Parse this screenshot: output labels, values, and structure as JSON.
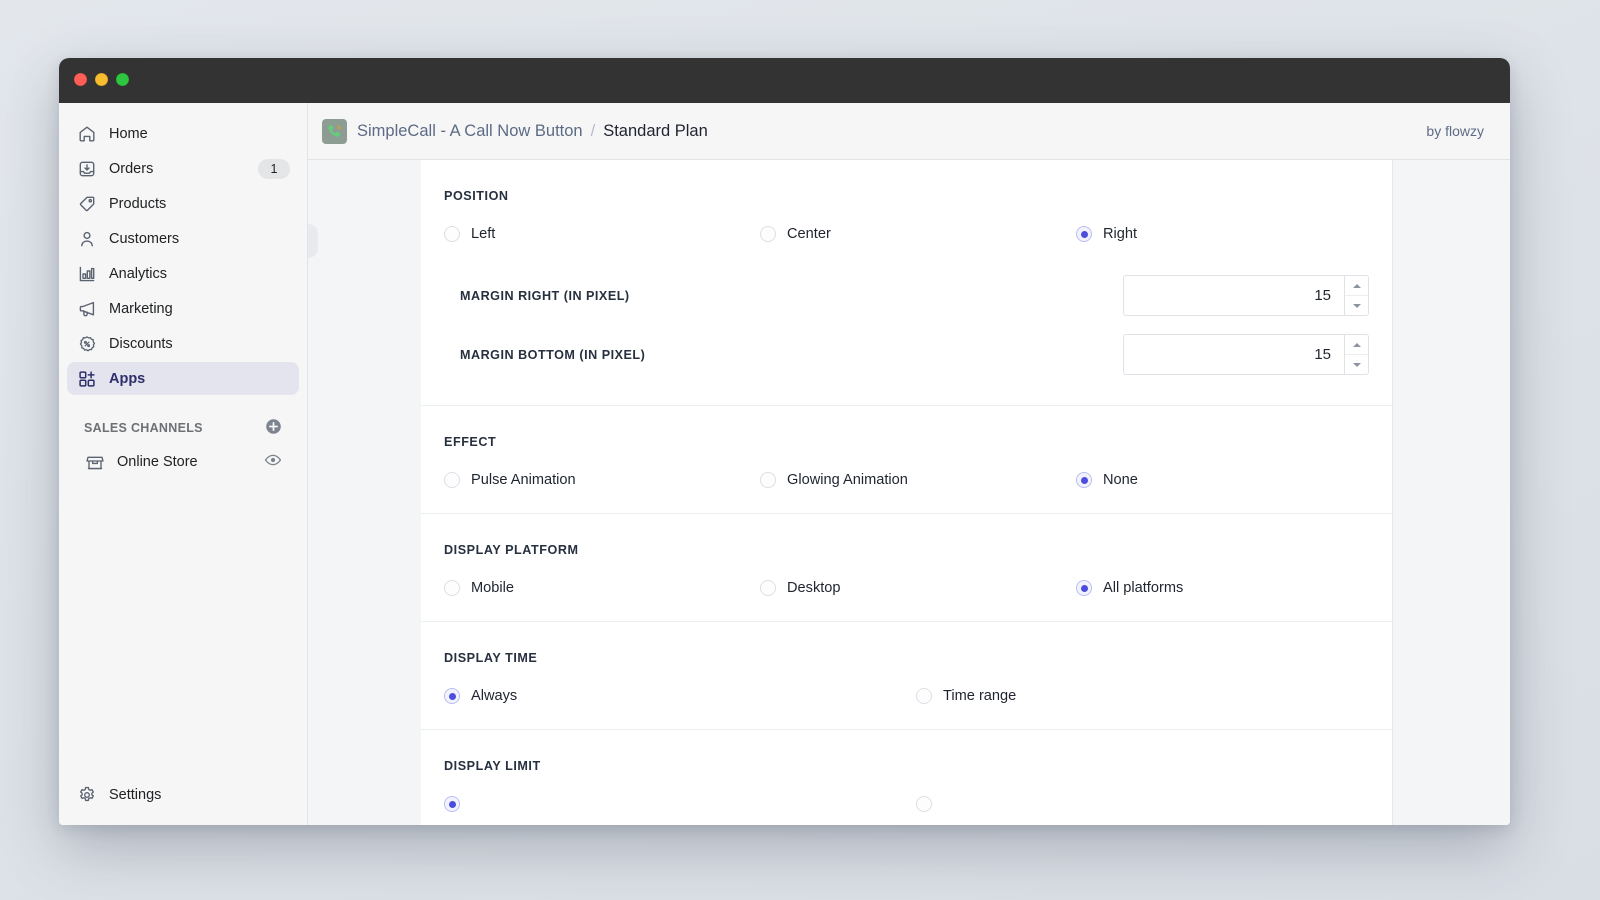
{
  "window": {
    "traffic_lights": [
      "close",
      "minimize",
      "zoom"
    ]
  },
  "sidebar": {
    "items": [
      {
        "label": "Home",
        "icon": "home-icon",
        "badge": null,
        "active": false
      },
      {
        "label": "Orders",
        "icon": "orders-inbox-icon",
        "badge": "1",
        "active": false
      },
      {
        "label": "Products",
        "icon": "product-tag-icon",
        "badge": null,
        "active": false
      },
      {
        "label": "Customers",
        "icon": "customer-person-icon",
        "badge": null,
        "active": false
      },
      {
        "label": "Analytics",
        "icon": "analytics-bars-icon",
        "badge": null,
        "active": false
      },
      {
        "label": "Marketing",
        "icon": "marketing-megaphone-icon",
        "badge": null,
        "active": false
      },
      {
        "label": "Discounts",
        "icon": "discount-percent-icon",
        "badge": null,
        "active": false
      },
      {
        "label": "Apps",
        "icon": "apps-grid-plus-icon",
        "badge": null,
        "active": true
      }
    ],
    "sales_channels": {
      "title": "SALES CHANNELS",
      "add_icon": "plus-circle-icon",
      "channels": [
        {
          "label": "Online Store",
          "icon": "storefront-icon",
          "trailing_icon": "eye-icon"
        }
      ]
    },
    "settings": {
      "label": "Settings",
      "icon": "gear-icon"
    }
  },
  "appbar": {
    "app_icon": "phone-call-app-icon",
    "breadcrumb_app": "SimpleCall - A Call Now Button",
    "breadcrumb_separator": "/",
    "breadcrumb_current": "Standard Plan",
    "byline": "by flowzy"
  },
  "colors": {
    "accent": "#4c4ddb",
    "sidebar_active_bg": "#e3e4ed",
    "title_bar": "#333333",
    "app_icon_bg": "#8e9d94",
    "phone_green": "#5fd07a"
  },
  "settings_panel": {
    "sections": [
      {
        "id": "position",
        "title": "POSITION",
        "options": [
          {
            "label": "Left",
            "selected": false
          },
          {
            "label": "Center",
            "selected": false
          },
          {
            "label": "Right",
            "selected": true
          }
        ],
        "fields": [
          {
            "label": "MARGIN RIGHT (IN PIXEL)",
            "value": "15",
            "unit": "pixel"
          },
          {
            "label": "MARGIN BOTTOM (IN PIXEL)",
            "value": "15",
            "unit": "pixel"
          }
        ]
      },
      {
        "id": "effect",
        "title": "EFFECT",
        "options": [
          {
            "label": "Pulse Animation",
            "selected": false
          },
          {
            "label": "Glowing Animation",
            "selected": false
          },
          {
            "label": "None",
            "selected": true
          }
        ]
      },
      {
        "id": "display_platform",
        "title": "DISPLAY PLATFORM",
        "options": [
          {
            "label": "Mobile",
            "selected": false
          },
          {
            "label": "Desktop",
            "selected": false
          },
          {
            "label": "All platforms",
            "selected": true
          }
        ]
      },
      {
        "id": "display_time",
        "title": "DISPLAY TIME",
        "options": [
          {
            "label": "Always",
            "selected": true
          },
          {
            "label": "Time range",
            "selected": false
          }
        ]
      },
      {
        "id": "display_limit",
        "title": "DISPLAY LIMIT",
        "options": []
      }
    ]
  }
}
